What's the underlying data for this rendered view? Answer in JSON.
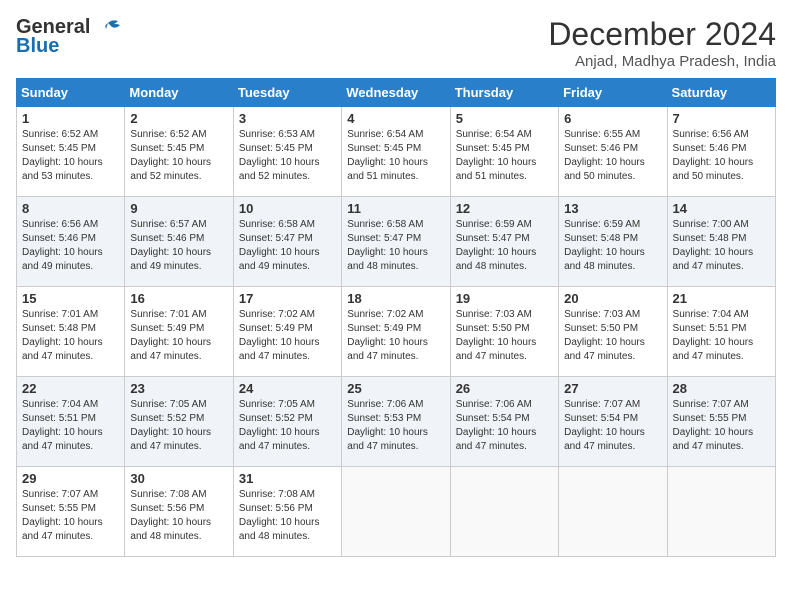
{
  "logo": {
    "line1": "General",
    "line2": "Blue"
  },
  "title": "December 2024",
  "location": "Anjad, Madhya Pradesh, India",
  "weekdays": [
    "Sunday",
    "Monday",
    "Tuesday",
    "Wednesday",
    "Thursday",
    "Friday",
    "Saturday"
  ],
  "weeks": [
    [
      {
        "day": "1",
        "sunrise": "6:52 AM",
        "sunset": "5:45 PM",
        "daylight": "10 hours and 53 minutes."
      },
      {
        "day": "2",
        "sunrise": "6:52 AM",
        "sunset": "5:45 PM",
        "daylight": "10 hours and 52 minutes."
      },
      {
        "day": "3",
        "sunrise": "6:53 AM",
        "sunset": "5:45 PM",
        "daylight": "10 hours and 52 minutes."
      },
      {
        "day": "4",
        "sunrise": "6:54 AM",
        "sunset": "5:45 PM",
        "daylight": "10 hours and 51 minutes."
      },
      {
        "day": "5",
        "sunrise": "6:54 AM",
        "sunset": "5:45 PM",
        "daylight": "10 hours and 51 minutes."
      },
      {
        "day": "6",
        "sunrise": "6:55 AM",
        "sunset": "5:46 PM",
        "daylight": "10 hours and 50 minutes."
      },
      {
        "day": "7",
        "sunrise": "6:56 AM",
        "sunset": "5:46 PM",
        "daylight": "10 hours and 50 minutes."
      }
    ],
    [
      {
        "day": "8",
        "sunrise": "6:56 AM",
        "sunset": "5:46 PM",
        "daylight": "10 hours and 49 minutes."
      },
      {
        "day": "9",
        "sunrise": "6:57 AM",
        "sunset": "5:46 PM",
        "daylight": "10 hours and 49 minutes."
      },
      {
        "day": "10",
        "sunrise": "6:58 AM",
        "sunset": "5:47 PM",
        "daylight": "10 hours and 49 minutes."
      },
      {
        "day": "11",
        "sunrise": "6:58 AM",
        "sunset": "5:47 PM",
        "daylight": "10 hours and 48 minutes."
      },
      {
        "day": "12",
        "sunrise": "6:59 AM",
        "sunset": "5:47 PM",
        "daylight": "10 hours and 48 minutes."
      },
      {
        "day": "13",
        "sunrise": "6:59 AM",
        "sunset": "5:48 PM",
        "daylight": "10 hours and 48 minutes."
      },
      {
        "day": "14",
        "sunrise": "7:00 AM",
        "sunset": "5:48 PM",
        "daylight": "10 hours and 47 minutes."
      }
    ],
    [
      {
        "day": "15",
        "sunrise": "7:01 AM",
        "sunset": "5:48 PM",
        "daylight": "10 hours and 47 minutes."
      },
      {
        "day": "16",
        "sunrise": "7:01 AM",
        "sunset": "5:49 PM",
        "daylight": "10 hours and 47 minutes."
      },
      {
        "day": "17",
        "sunrise": "7:02 AM",
        "sunset": "5:49 PM",
        "daylight": "10 hours and 47 minutes."
      },
      {
        "day": "18",
        "sunrise": "7:02 AM",
        "sunset": "5:49 PM",
        "daylight": "10 hours and 47 minutes."
      },
      {
        "day": "19",
        "sunrise": "7:03 AM",
        "sunset": "5:50 PM",
        "daylight": "10 hours and 47 minutes."
      },
      {
        "day": "20",
        "sunrise": "7:03 AM",
        "sunset": "5:50 PM",
        "daylight": "10 hours and 47 minutes."
      },
      {
        "day": "21",
        "sunrise": "7:04 AM",
        "sunset": "5:51 PM",
        "daylight": "10 hours and 47 minutes."
      }
    ],
    [
      {
        "day": "22",
        "sunrise": "7:04 AM",
        "sunset": "5:51 PM",
        "daylight": "10 hours and 47 minutes."
      },
      {
        "day": "23",
        "sunrise": "7:05 AM",
        "sunset": "5:52 PM",
        "daylight": "10 hours and 47 minutes."
      },
      {
        "day": "24",
        "sunrise": "7:05 AM",
        "sunset": "5:52 PM",
        "daylight": "10 hours and 47 minutes."
      },
      {
        "day": "25",
        "sunrise": "7:06 AM",
        "sunset": "5:53 PM",
        "daylight": "10 hours and 47 minutes."
      },
      {
        "day": "26",
        "sunrise": "7:06 AM",
        "sunset": "5:54 PM",
        "daylight": "10 hours and 47 minutes."
      },
      {
        "day": "27",
        "sunrise": "7:07 AM",
        "sunset": "5:54 PM",
        "daylight": "10 hours and 47 minutes."
      },
      {
        "day": "28",
        "sunrise": "7:07 AM",
        "sunset": "5:55 PM",
        "daylight": "10 hours and 47 minutes."
      }
    ],
    [
      {
        "day": "29",
        "sunrise": "7:07 AM",
        "sunset": "5:55 PM",
        "daylight": "10 hours and 47 minutes."
      },
      {
        "day": "30",
        "sunrise": "7:08 AM",
        "sunset": "5:56 PM",
        "daylight": "10 hours and 48 minutes."
      },
      {
        "day": "31",
        "sunrise": "7:08 AM",
        "sunset": "5:56 PM",
        "daylight": "10 hours and 48 minutes."
      },
      null,
      null,
      null,
      null
    ]
  ]
}
